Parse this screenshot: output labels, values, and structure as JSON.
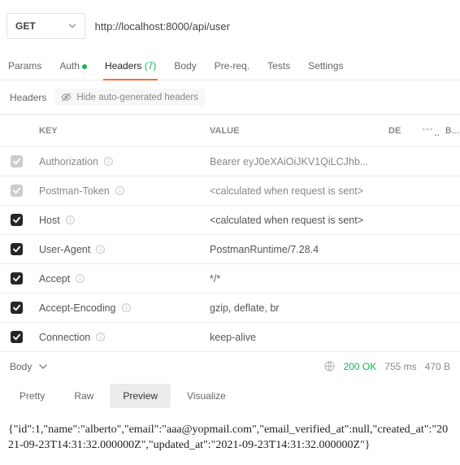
{
  "request": {
    "method": "GET",
    "url": "http://localhost:8000/api/user"
  },
  "tabs": {
    "params": "Params",
    "auth": "Auth",
    "headers": "Headers",
    "headers_count": "(7)",
    "body": "Body",
    "prereq": "Pre-req.",
    "tests": "Tests",
    "settings": "Settings"
  },
  "headers_toolbar": {
    "label": "Headers",
    "hide_btn": "Hide auto-generated headers"
  },
  "table": {
    "col_key": "KEY",
    "col_value": "VALUE",
    "col_de": "DE",
    "col_bulk": "Bulk",
    "rows": [
      {
        "enabled": false,
        "key": "Authorization",
        "value": "Bearer eyJ0eXAiOiJKV1QiLCJhb..."
      },
      {
        "enabled": false,
        "key": "Postman-Token",
        "value": "<calculated when request is sent>"
      },
      {
        "enabled": true,
        "key": "Host",
        "value": "<calculated when request is sent>"
      },
      {
        "enabled": true,
        "key": "User-Agent",
        "value": "PostmanRuntime/7.28.4"
      },
      {
        "enabled": true,
        "key": "Accept",
        "value": "*/*"
      },
      {
        "enabled": true,
        "key": "Accept-Encoding",
        "value": "gzip, deflate, br"
      },
      {
        "enabled": true,
        "key": "Connection",
        "value": "keep-alive"
      }
    ]
  },
  "response": {
    "section_label": "Body",
    "status": "200 OK",
    "time": "755 ms",
    "size": "470 B",
    "tabs": {
      "pretty": "Pretty",
      "raw": "Raw",
      "preview": "Preview",
      "visualize": "Visualize"
    },
    "body_text": "{\"id\":1,\"name\":\"alberto\",\"email\":\"aaa@yopmail.com\",\"email_verified_at\":null,\"created_at\":\"2021-09-23T14:31:32.000000Z\",\"updated_at\":\"2021-09-23T14:31:32.000000Z\"}"
  }
}
